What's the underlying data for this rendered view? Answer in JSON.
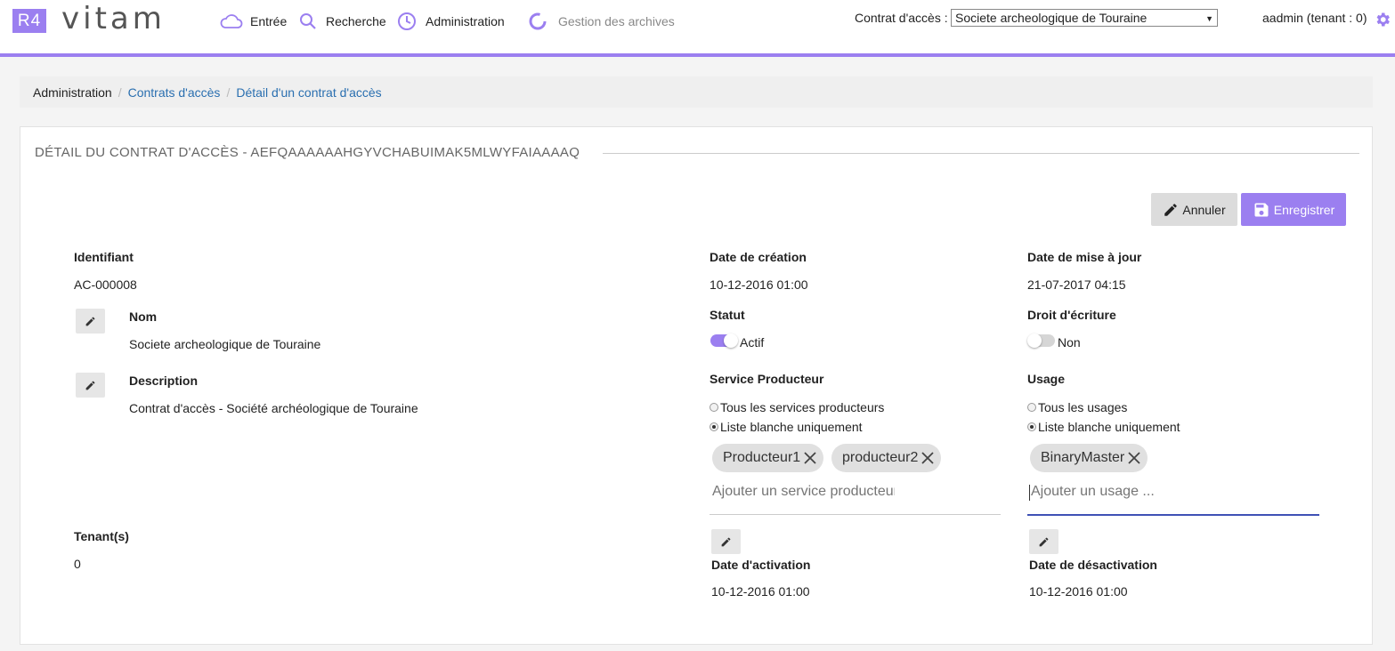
{
  "header": {
    "logo_badge": "R4",
    "logo_text": "vitam",
    "nav": [
      {
        "label": "Entrée",
        "icon": "cloud-icon"
      },
      {
        "label": "Recherche",
        "icon": "search-icon"
      },
      {
        "label": "Administration",
        "icon": "clock-icon"
      },
      {
        "label": "Gestion des archives",
        "icon": "loading-ring-icon"
      }
    ],
    "contract_label": "Contrat d'accès :",
    "contract_value": "Societe archeologique de Touraine",
    "user": "aadmin (tenant : 0)",
    "accent_color": "#9b7ff0"
  },
  "breadcrumb": {
    "items": [
      "Administration",
      "Contrats d'accès",
      "Détail d'un contrat d'accès"
    ],
    "separator": "/"
  },
  "panel": {
    "title": "DÉTAIL DU CONTRAT D'ACCÈS - AEFQAAAAAAHGYVCHABUIMAK5MLWYFAIAAAAQ",
    "cancel_label": "Annuler",
    "save_label": "Enregistrer"
  },
  "fields": {
    "identifiant": {
      "label": "Identifiant",
      "value": "AC-000008"
    },
    "nom": {
      "label": "Nom",
      "value": "Societe archeologique de Touraine"
    },
    "description": {
      "label": "Description",
      "value": "Contrat d'accès - Société archéologique de Touraine"
    },
    "tenants": {
      "label": "Tenant(s)",
      "value": "0"
    },
    "date_creation": {
      "label": "Date de création",
      "value": "10-12-2016 01:00"
    },
    "date_maj": {
      "label": "Date de mise à jour",
      "value": "21-07-2017 04:15"
    },
    "statut": {
      "label": "Statut",
      "value": "Actif",
      "on": true
    },
    "droit_ecriture": {
      "label": "Droit d'écriture",
      "value": "Non",
      "on": false
    },
    "service_producteur": {
      "label": "Service Producteur",
      "options": [
        "Tous les services producteurs",
        "Liste blanche uniquement"
      ],
      "selected": "Liste blanche uniquement",
      "chips": [
        "Producteur1",
        "producteur2"
      ],
      "placeholder": "Ajouter un service producteur ..."
    },
    "usage": {
      "label": "Usage",
      "options": [
        "Tous les usages",
        "Liste blanche uniquement"
      ],
      "selected": "Liste blanche uniquement",
      "chips": [
        "BinaryMaster"
      ],
      "placeholder": "Ajouter un usage ..."
    },
    "date_activation": {
      "label": "Date d'activation",
      "value": "10-12-2016 01:00"
    },
    "date_desactivation": {
      "label": "Date de désactivation",
      "value": "10-12-2016 01:00"
    }
  }
}
